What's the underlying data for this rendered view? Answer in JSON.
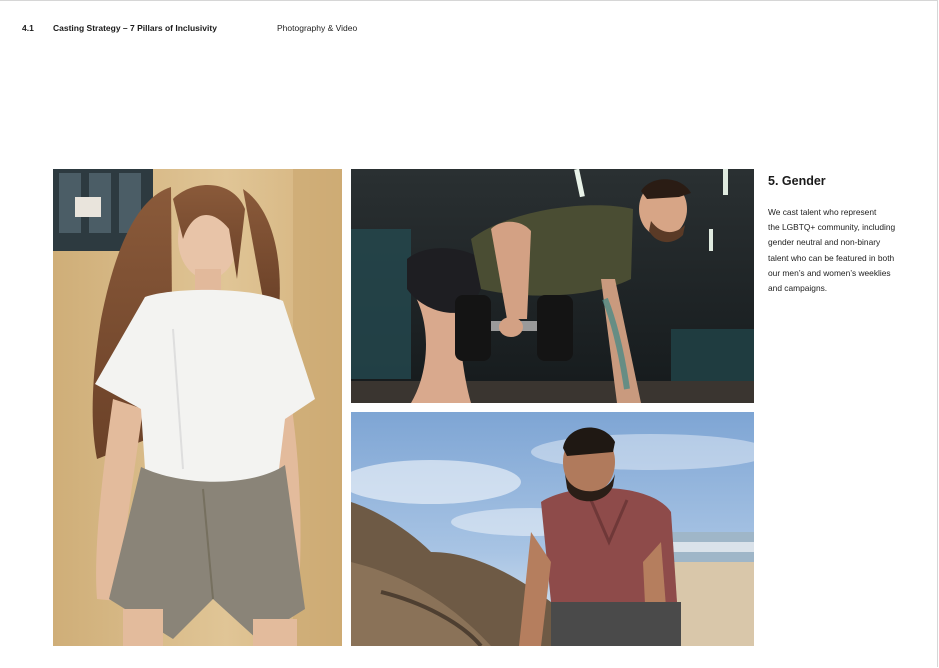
{
  "header": {
    "section_number": "4.1",
    "section_title": "Casting Strategy – 7 Pillars of Inclusivity",
    "category": "Photography & Video"
  },
  "pillar": {
    "heading": "5. Gender",
    "body_lines": [
      "We cast talent who represent",
      "the LGBTQ+ community, including",
      "gender neutral and non-binary",
      "talent who can be featured in both",
      "our men’s and women’s weeklies",
      "and campaigns."
    ]
  },
  "colors": {
    "wall_beige": "#d9bd8a",
    "tshirt_white": "#f3f3f1",
    "shorts_taupe": "#8a8478",
    "gym_dark": "#1c2326",
    "tank_olive": "#4a4d33",
    "sky_blue": "#8fb3dc",
    "shirt_rust": "#8e4b4a",
    "rock_brown": "#6e5a45"
  }
}
